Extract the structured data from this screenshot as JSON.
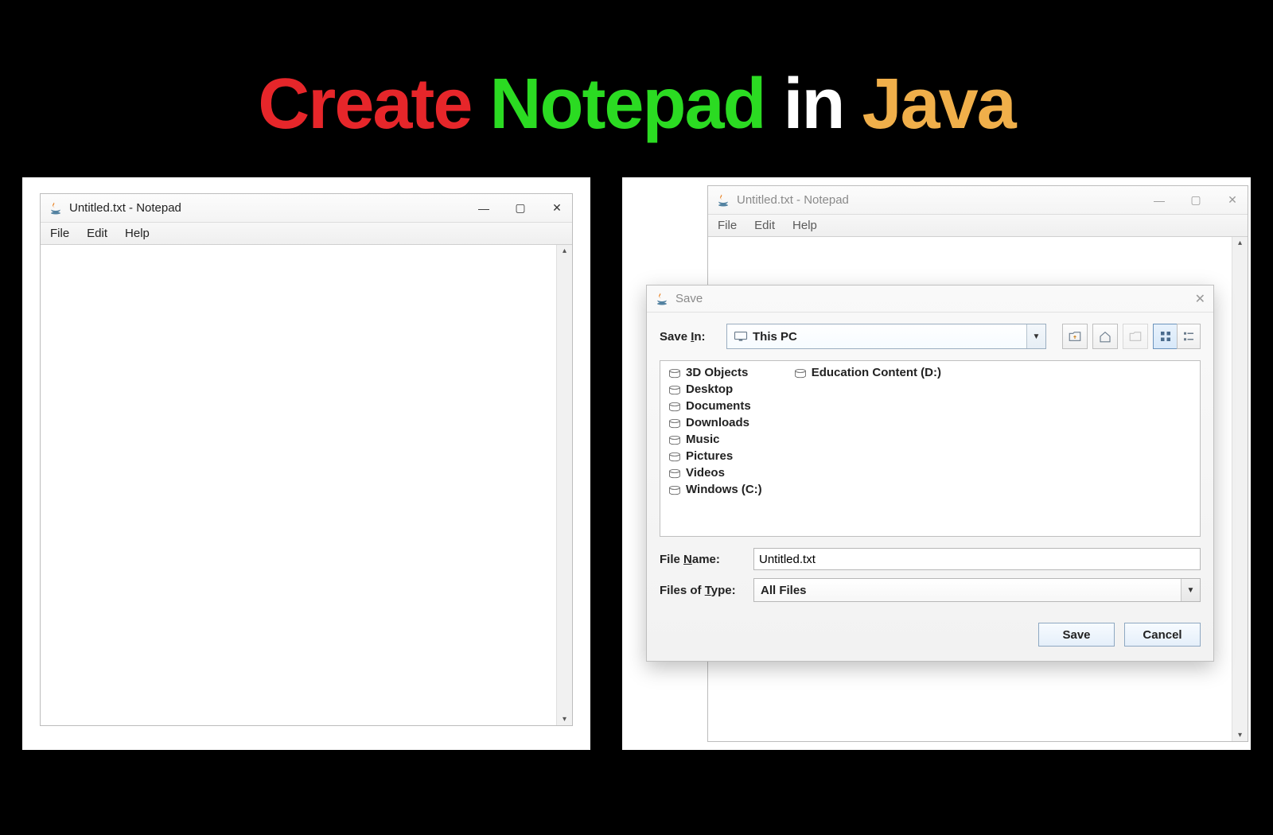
{
  "heading": {
    "w1": "Create",
    "w2": "Notepad",
    "w3": "in",
    "w4": "Java"
  },
  "notepad_left": {
    "title": "Untitled.txt - Notepad",
    "menus": {
      "file": "File",
      "edit": "Edit",
      "help": "Help"
    },
    "content": ""
  },
  "notepad_right": {
    "title": "Untitled.txt - Notepad",
    "menus": {
      "file": "File",
      "edit": "Edit",
      "help": "Help"
    },
    "content": ""
  },
  "save_dialog": {
    "title": "Save",
    "save_in_label": "Save In:",
    "save_in_value": "This PC",
    "files_col1": [
      "3D Objects",
      "Desktop",
      "Documents",
      "Downloads",
      "Music",
      "Pictures",
      "Videos",
      "Windows (C:)"
    ],
    "files_col2": [
      "Education Content (D:)"
    ],
    "file_name_label_pre": "File ",
    "file_name_label_ul": "N",
    "file_name_label_post": "ame:",
    "file_name_value": "Untitled.txt",
    "file_type_label_pre": "Files of ",
    "file_type_label_ul": "T",
    "file_type_label_post": "ype:",
    "file_type_value": "All Files",
    "save_btn": "Save",
    "cancel_btn": "Cancel",
    "save_in_label_ul": "I"
  }
}
